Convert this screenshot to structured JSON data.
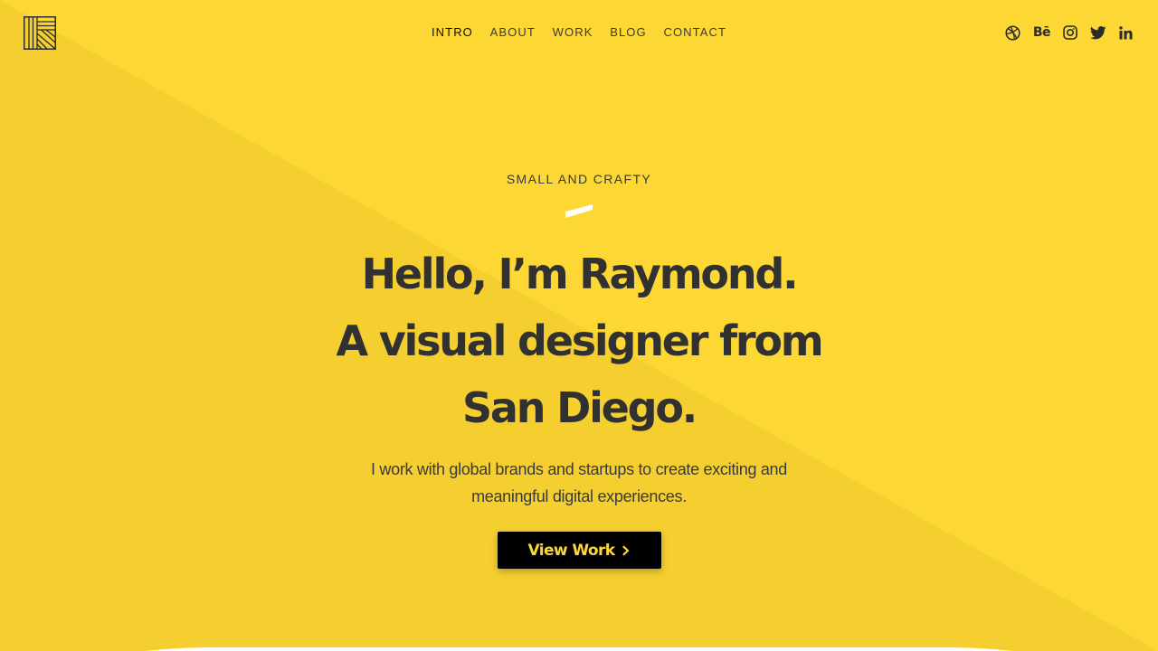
{
  "colors": {
    "background": "#fdd835",
    "background_shade": "#f5cf30",
    "text_dark": "#313131",
    "button_bg": "#000000",
    "button_text": "#fdd835",
    "accent_dash": "#ffffff"
  },
  "logo": {
    "icon": "striped-square-logo-icon"
  },
  "nav": {
    "items": [
      {
        "label": "INTRO",
        "active": true
      },
      {
        "label": "ABOUT",
        "active": false
      },
      {
        "label": "WORK",
        "active": false
      },
      {
        "label": "BLOG",
        "active": false
      },
      {
        "label": "CONTACT",
        "active": false
      }
    ]
  },
  "socials": {
    "dribbble": "dribbble-icon",
    "behance_label": "Bē",
    "instagram": "instagram-icon",
    "twitter": "twitter-icon",
    "linkedin_label": "in"
  },
  "hero": {
    "eyebrow": "SMALL AND CRAFTY",
    "headline_lines": [
      "Hello, I’m Raymond.",
      "A visual designer from",
      "San Diego."
    ],
    "lead_lines": [
      "I work with global brands and startups to create exciting and",
      "meaningful digital experiences."
    ],
    "cta_label": "View Work",
    "cta_icon": "chevron-right-icon"
  }
}
